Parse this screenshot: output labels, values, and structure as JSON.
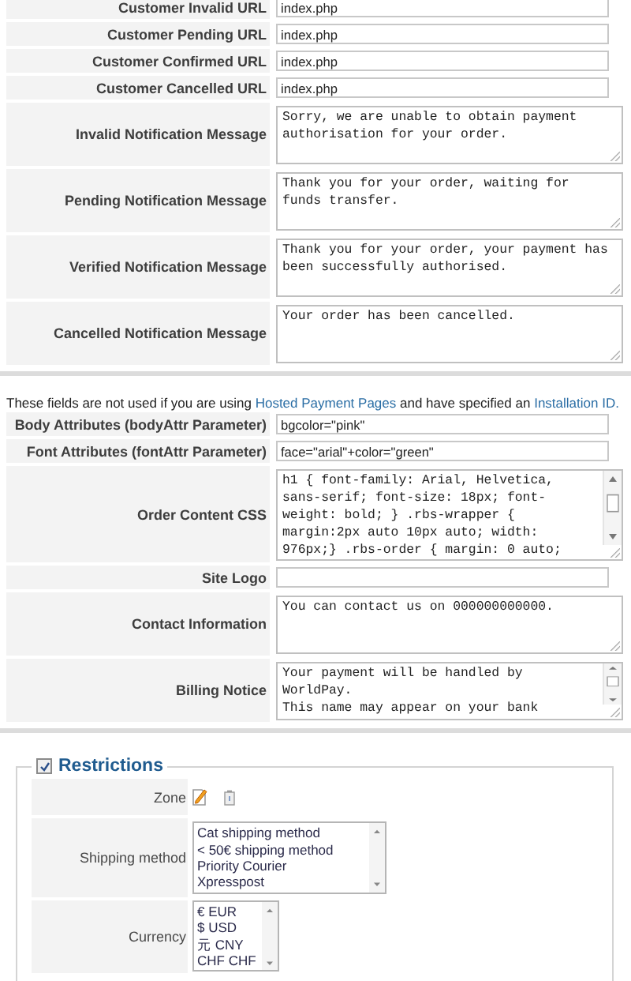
{
  "payment_fields": [
    {
      "kind": "input",
      "label": "Customer Invalid URL",
      "value": "index.php"
    },
    {
      "kind": "input",
      "label": "Customer Pending URL",
      "value": "index.php"
    },
    {
      "kind": "input",
      "label": "Customer Confirmed URL",
      "value": "index.php"
    },
    {
      "kind": "input",
      "label": "Customer Cancelled URL",
      "value": "index.php"
    },
    {
      "kind": "textarea",
      "label": "Invalid Notification Message",
      "value": "Sorry, we are unable to obtain payment authorisation for your order.",
      "scrollbar": false
    },
    {
      "kind": "textarea",
      "label": "Pending Notification Message",
      "value": "Thank you for your order, waiting for funds transfer.",
      "scrollbar": false
    },
    {
      "kind": "textarea",
      "label": "Verified Notification Message",
      "value": "Thank you for your order, your payment has been successfully authorised.",
      "scrollbar": false
    },
    {
      "kind": "textarea",
      "label": "Cancelled Notification Message",
      "value": "Your order has been cancelled.",
      "scrollbar": false
    }
  ],
  "note": [
    {
      "kind": "text",
      "text": "These fields are not used if you are using "
    },
    {
      "kind": "link",
      "text": "Hosted Payment Pages"
    },
    {
      "kind": "text",
      "text": " and have specified an "
    },
    {
      "kind": "link",
      "text": "Installation ID."
    }
  ],
  "html_fields": [
    {
      "kind": "input",
      "label": "Body Attributes (bodyAttr Parameter)",
      "value": "bgcolor=\"pink\""
    },
    {
      "kind": "input",
      "label": "Font Attributes (fontAttr Parameter)",
      "value": "face=\"arial\"+color=\"green\""
    },
    {
      "kind": "textarea",
      "label": "Order Content CSS",
      "value": "h1 { font-family: Arial, Helvetica, sans-serif; font-size: 18px; font-weight: bold; } .rbs-wrapper { margin:2px auto 10px auto; width: 976px;} .rbs-order { margin: 0 auto;",
      "scrollbar": true
    },
    {
      "kind": "input",
      "label": "Site Logo"
    },
    {
      "kind": "textarea",
      "label": "Contact Information",
      "value": "You can contact us on 000000000000.",
      "scrollbar": false
    },
    {
      "kind": "textarea",
      "label": "Billing Notice",
      "value": "Your payment will be handled by WorldPay.\nThis name may appear on your bank",
      "scrollbar": true
    }
  ],
  "restrictions": {
    "label": "Restrictions",
    "checked": true,
    "rows": [
      {
        "kind": "icons",
        "label": "Zone"
      },
      {
        "kind": "list",
        "label": "Shipping method",
        "options": [
          "Cat shipping method",
          "< 50€ shipping method",
          "Priority Courier",
          "Xpresspost"
        ]
      },
      {
        "kind": "list",
        "label": "Currency",
        "options": [
          "€ EUR",
          "$ USD",
          "元 CNY",
          "CHF CHF"
        ]
      }
    ]
  }
}
